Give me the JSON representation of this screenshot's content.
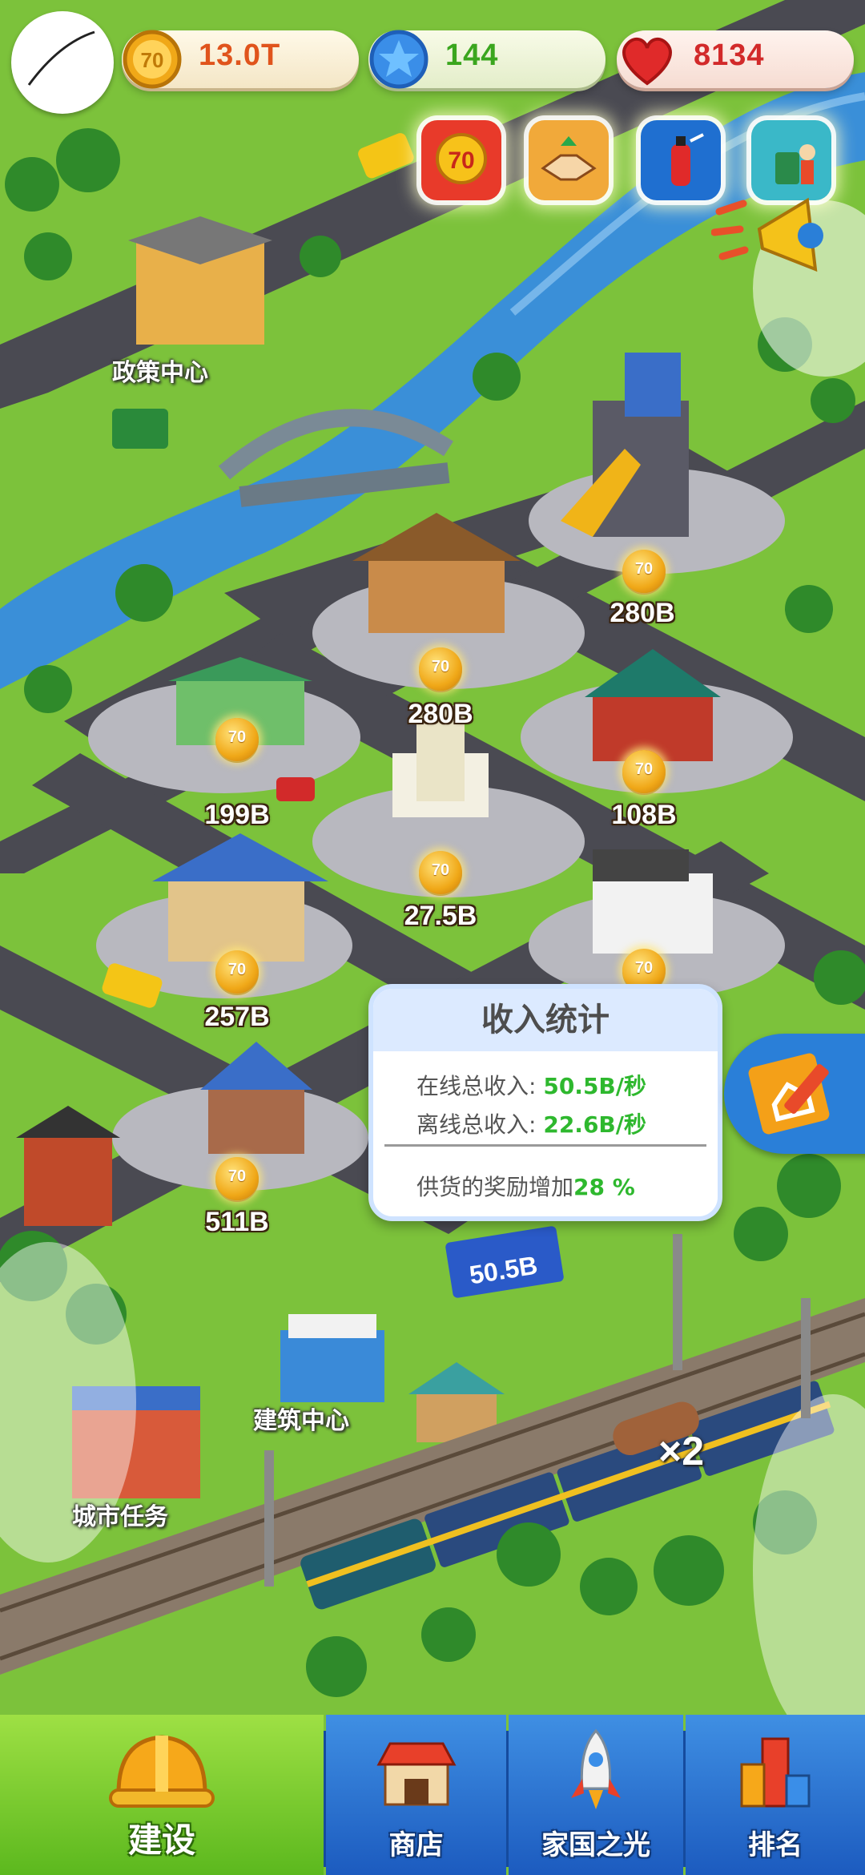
{
  "hud": {
    "coins": "13.0T",
    "gems": "144",
    "hearts": "8134"
  },
  "top_icons": [
    "70th-anniversary-icon",
    "handshake-icon",
    "fire-safety-icon",
    "recycling-icon"
  ],
  "landmarks": {
    "policy_center": "政策中心",
    "architecture_center": "建筑中心",
    "city_tasks": "城市任务"
  },
  "building_incomes": [
    {
      "name": "lumber-mill",
      "value": "280B"
    },
    {
      "name": "steel-mill",
      "value": "280B"
    },
    {
      "name": "food-factory",
      "value": "199B"
    },
    {
      "name": "tower",
      "value": "27.5B"
    },
    {
      "name": "temple",
      "value": "108B"
    },
    {
      "name": "vegetable-market",
      "value": "257B"
    },
    {
      "name": "old-house",
      "value": "511B"
    }
  ],
  "stats_panel": {
    "title": "收入统计",
    "online_label": "在线总收入: ",
    "online_value": "50.5B/秒",
    "offline_label": "离线总收入: ",
    "offline_value": "22.6B/秒",
    "bonus_label": "供货的奖励增加",
    "bonus_value": "28 %"
  },
  "billboard": "50.5B",
  "train_multiplier": "×2",
  "nav": {
    "build": "建设",
    "shop": "商店",
    "national_light": "家国之光",
    "ranking": "排名"
  },
  "colors": {
    "grass": "#7cc23b",
    "road": "#4a4a52",
    "river": "#3a8fd8",
    "nav_active": "#7ccf2e",
    "nav_tab": "#2a72d2"
  }
}
